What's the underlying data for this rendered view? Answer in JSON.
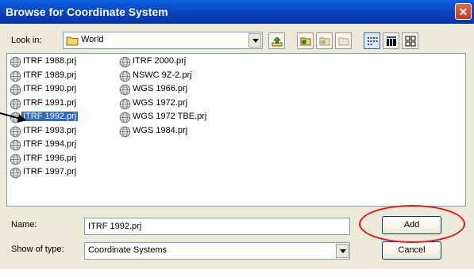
{
  "dialog": {
    "title": "Browse for Coordinate System",
    "close_glyph": "✕"
  },
  "look_in": {
    "label": "Look in:",
    "value": "World",
    "icon": "folder-icon"
  },
  "toolbar": {
    "icons": [
      "up-one-level-icon",
      "connect-folder-icon",
      "disconnect-folder-icon",
      "new-folder-icon",
      "list-view-icon",
      "details-view-icon",
      "thumbnails-view-icon"
    ]
  },
  "files": {
    "icon": "globe-icon",
    "items": [
      "ITRF 1988.prj",
      "ITRF 1989.prj",
      "ITRF 1990.prj",
      "ITRF 1991.prj",
      "ITRF 1992.prj",
      "ITRF 1993.prj",
      "ITRF 1994.prj",
      "ITRF 1996.prj",
      "ITRF 1997.prj",
      "ITRF 2000.prj",
      "NSWC 9Z-2.prj",
      "WGS 1966.prj",
      "WGS 1972.prj",
      "WGS 1972 TBE.prj",
      "WGS 1984.prj"
    ],
    "selected": "ITRF 1992.prj"
  },
  "name_field": {
    "label": "Name:",
    "value": "ITRF 1992.prj"
  },
  "type_field": {
    "label": "Show of type:",
    "value": "Coordinate Systems"
  },
  "buttons": {
    "add": "Add",
    "cancel": "Cancel"
  },
  "annotation": {
    "color": "#e8141a",
    "arrow_color": "#000000"
  }
}
